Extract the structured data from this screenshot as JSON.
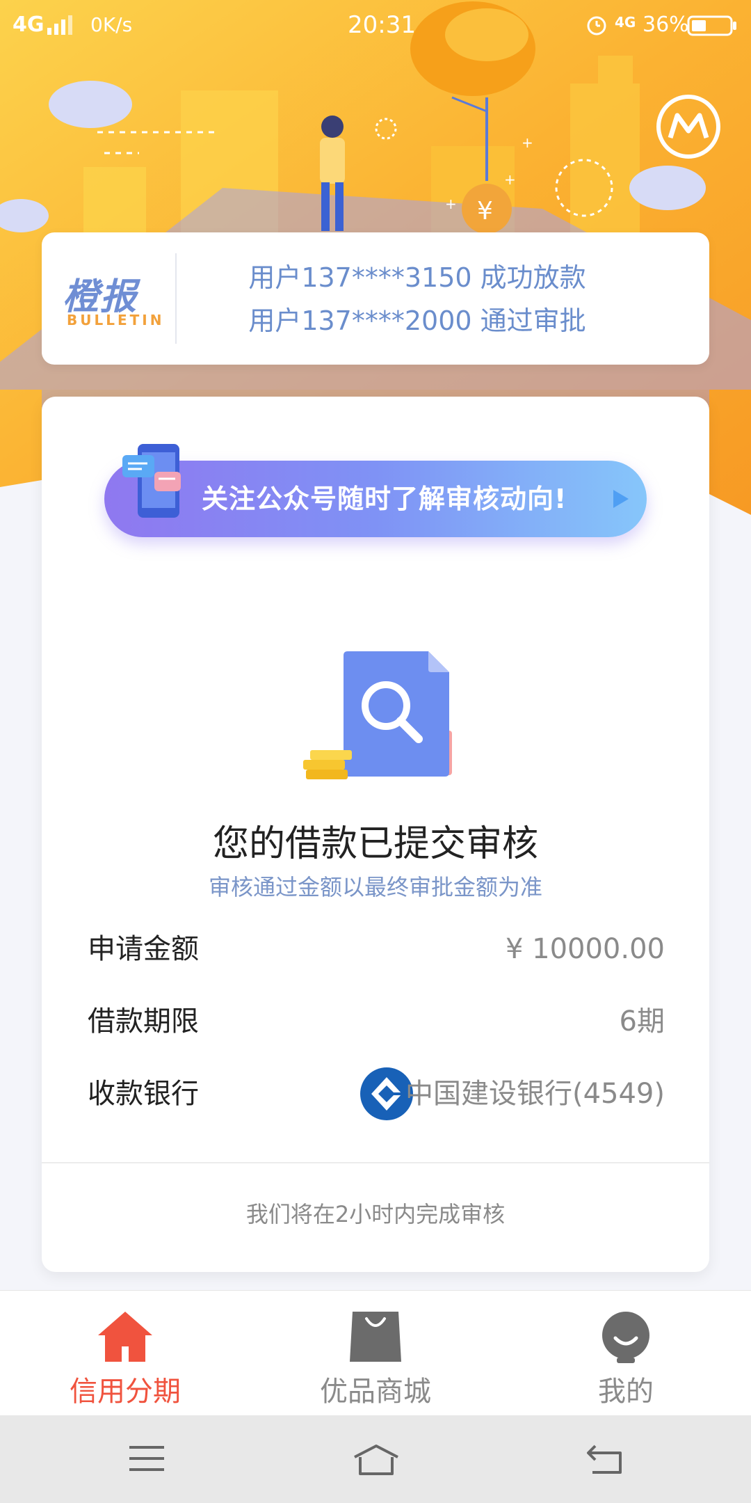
{
  "status_bar": {
    "network": "4G",
    "speed": "0K/s",
    "time": "20:31",
    "network_right": "4G",
    "battery": "36%"
  },
  "bulletin": {
    "brand": "橙报",
    "brand_sub": "BULLETIN",
    "lines": [
      "用户137****3150 成功放款",
      "用户137****2000 通过审批"
    ]
  },
  "banner": {
    "text": "关注公众号随时了解审核动向!"
  },
  "review": {
    "title": "您的借款已提交审核",
    "subtitle": "审核通过金额以最终审批金额为准"
  },
  "details": {
    "amount_label": "申请金额",
    "amount_value": "¥ 10000.00",
    "term_label": "借款期限",
    "term_value": "6期",
    "bank_label": "收款银行",
    "bank_value": "中国建设银行(4549)"
  },
  "footer_note": "我们将在2小时内完成审核",
  "tabs": [
    {
      "label": "信用分期",
      "icon": "home-icon",
      "active": true
    },
    {
      "label": "优品商城",
      "icon": "shopping-bag-icon",
      "active": false
    },
    {
      "label": "我的",
      "icon": "profile-icon",
      "active": false
    }
  ],
  "colors": {
    "accent": "#f0533e",
    "hero_orange": "#f9a825",
    "blue_text": "#6a8dcc",
    "banner_purple": "#8f78f0",
    "banner_blue": "#86c6fa"
  }
}
